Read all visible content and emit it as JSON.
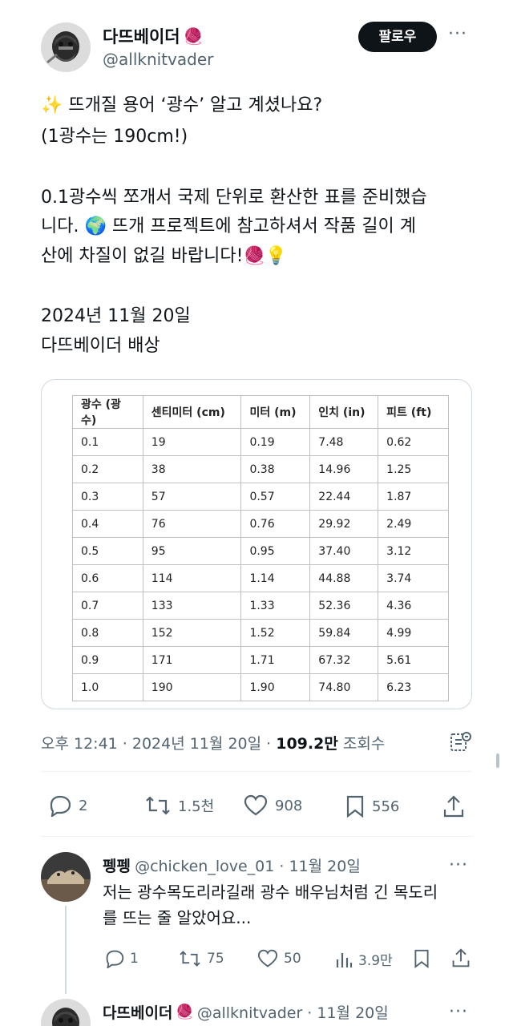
{
  "tweet": {
    "author_name": "다뜨베이더",
    "author_emoji": "🧶",
    "author_handle": "@allknitvader",
    "follow_label": "팔로우",
    "more": "···",
    "line1_emoji": "✨",
    "line1": "뜨개질 용어 ‘광수’ 알고 계셨나요?",
    "line2": "(1광수는 190cm!)",
    "line3": "0.1광수씩 쪼개서 국제 단위로 환산한 표를 준비했습",
    "line4_a": "니다.",
    "line4_emoji": "🌍",
    "line4_b": "뜨개 프로젝트에 참고하셔서 작품 길이 계",
    "line5": "산에 차질이 없길 바랍니다!",
    "line5_emojis": "🧶💡",
    "line6": "2024년 11월 20일",
    "line7": "다뜨베이더 배상"
  },
  "table": {
    "headers": [
      "광수 (광수)",
      "센티미터 (cm)",
      "미터 (m)",
      "인치 (in)",
      "피트 (ft)"
    ],
    "rows": [
      [
        "0.1",
        "19",
        "0.19",
        "7.48",
        "0.62"
      ],
      [
        "0.2",
        "38",
        "0.38",
        "14.96",
        "1.25"
      ],
      [
        "0.3",
        "57",
        "0.57",
        "22.44",
        "1.87"
      ],
      [
        "0.4",
        "76",
        "0.76",
        "29.92",
        "2.49"
      ],
      [
        "0.5",
        "95",
        "0.95",
        "37.40",
        "3.12"
      ],
      [
        "0.6",
        "114",
        "1.14",
        "44.88",
        "3.74"
      ],
      [
        "0.7",
        "133",
        "1.33",
        "52.36",
        "4.36"
      ],
      [
        "0.8",
        "152",
        "1.52",
        "59.84",
        "4.99"
      ],
      [
        "0.9",
        "171",
        "1.71",
        "67.32",
        "5.61"
      ],
      [
        "1.0",
        "190",
        "1.90",
        "74.80",
        "6.23"
      ]
    ]
  },
  "meta": {
    "time": "오후 12:41 · 2024년 11월 20일 · ",
    "views_count": "109.2만",
    "views_label": " 조회수"
  },
  "actions": {
    "replies": "2",
    "retweets": "1.5천",
    "likes": "908",
    "bookmarks": "556"
  },
  "reply": {
    "name": "펭펭",
    "meta": "@chicken_love_01 · 11월 20일",
    "more": "···",
    "text1": "저는 광수목도리라길래 광수 배우님처럼 긴 목도리",
    "text2": "를 뜨는 줄 알았어요...",
    "replies": "1",
    "retweets": "75",
    "likes": "50",
    "views": "3.9만"
  },
  "reply2": {
    "name": "다뜨베이더",
    "emoji": "🧶",
    "meta": "@allknitvader · 11월 20일",
    "more": "···"
  },
  "colors": {
    "text": "#0f1419",
    "secondary": "#536471",
    "border": "#cfd9de",
    "button": "#0f1419"
  }
}
